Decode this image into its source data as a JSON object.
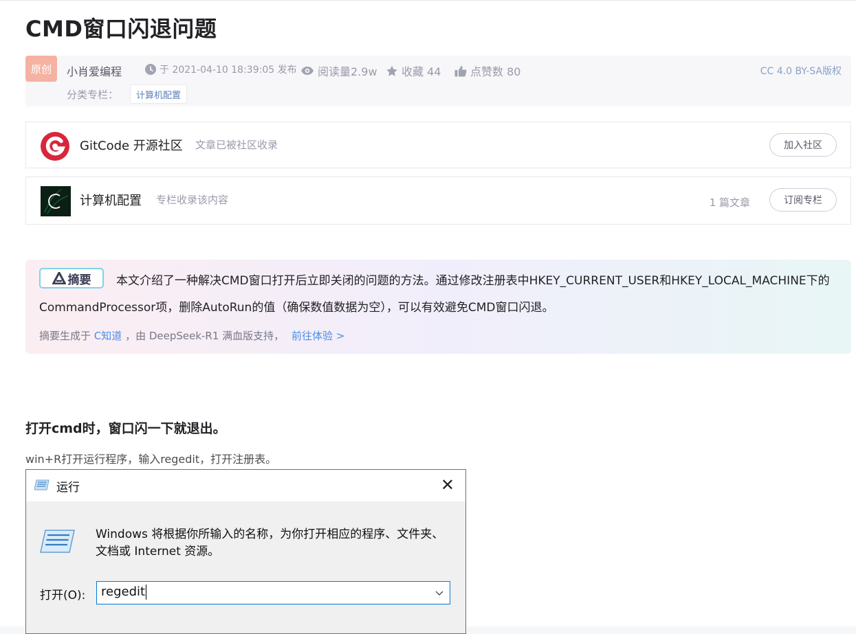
{
  "article": {
    "title": "CMD窗口闪退问题",
    "original_badge": "原创",
    "author": "小肖爱编程",
    "published": "于 2021-04-10 18:39:05 发布",
    "views": "阅读量2.9w",
    "favorites": "收藏 44",
    "likes": "点赞数 80",
    "license": "CC 4.0 BY-SA版权",
    "category_label": "分类专栏：",
    "category_tag": "计算机配置"
  },
  "community_card": {
    "name": "GitCode 开源社区",
    "desc": "文章已被社区收录",
    "button": "加入社区"
  },
  "column_card": {
    "name": "计算机配置",
    "desc": "专栏收录该内容",
    "count": "1 篇文章",
    "button": "订阅专栏"
  },
  "summary": {
    "badge": "摘要",
    "text": "本文介绍了一种解决CMD窗口打开后立即关闭的问题的方法。通过修改注册表中HKEY_CURRENT_USER和HKEY_LOCAL_MACHINE下的CommandProcessor项，删除AutoRun的值（确保数值数据为空），可以有效避免CMD窗口闪退。",
    "foot_prefix": "摘要生成于",
    "foot_link": "C知道",
    "foot_middle": "，由 DeepSeek-R1 满血版支持，",
    "foot_action": "前往体验 >"
  },
  "content": {
    "heading": "打开cmd时，窗口闪一下就退出。",
    "paragraph": "win+R打开运行程序，输入regedit，打开注册表。"
  },
  "run_dialog": {
    "title": "运行",
    "message": "Windows 将根据你所输入的名称，为你打开相应的程序、文件夹、文档或 Internet 资源。",
    "open_label": "打开(O):",
    "input_value": "regedit"
  },
  "colors": {
    "original_badge": "#f5b2a2",
    "link": "#4a8ee6",
    "license": "#88a1c7",
    "focus_border": "#0078d7"
  }
}
